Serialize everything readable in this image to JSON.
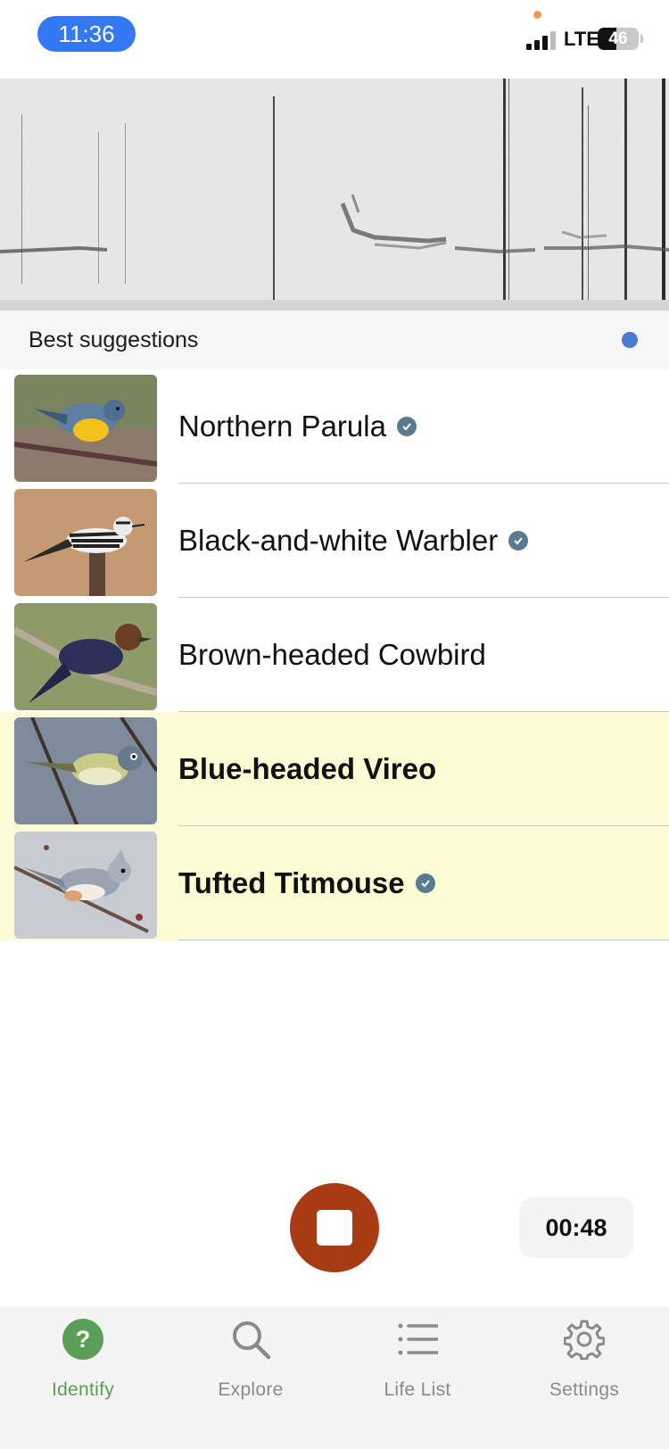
{
  "status_bar": {
    "time": "11:36",
    "network": "LTE",
    "battery": "46",
    "battery_level": 0.46
  },
  "suggestions": {
    "title": "Best suggestions"
  },
  "species": [
    {
      "name": "Northern Parula",
      "verified": true,
      "highlighted": false
    },
    {
      "name": "Black-and-white Warbler",
      "verified": true,
      "highlighted": false
    },
    {
      "name": "Brown-headed Cowbird",
      "verified": false,
      "highlighted": false
    },
    {
      "name": "Blue-headed Vireo",
      "verified": false,
      "highlighted": true
    },
    {
      "name": "Tufted Titmouse",
      "verified": true,
      "highlighted": true
    }
  ],
  "recording": {
    "timer": "00:48"
  },
  "tabs": [
    {
      "label": "Identify",
      "icon": "question-icon",
      "active": true
    },
    {
      "label": "Explore",
      "icon": "search-icon",
      "active": false
    },
    {
      "label": "Life List",
      "icon": "list-icon",
      "active": false
    },
    {
      "label": "Settings",
      "icon": "gear-icon",
      "active": false
    }
  ],
  "colors": {
    "accent_green": "#5a9e57",
    "stop_button": "#a83a14",
    "highlight_row": "#fdfbd4",
    "time_pill": "#3478f6"
  }
}
